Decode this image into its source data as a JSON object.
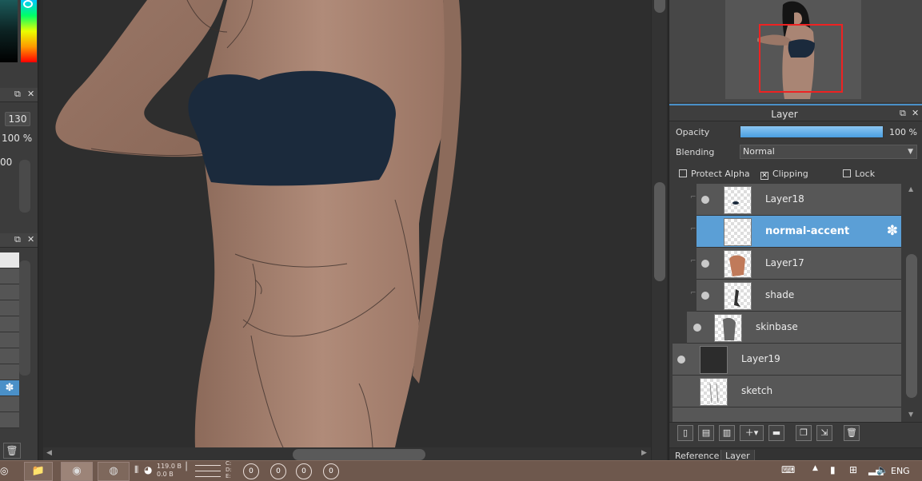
{
  "left_panel": {
    "brush_size": "130",
    "opacity_text": "100 %",
    "partial_value": "00"
  },
  "layer_panel": {
    "title": "Layer",
    "opacity_label": "Opacity",
    "opacity_value": "100 %",
    "opacity_fraction": 1.0,
    "blending_label": "Blending",
    "blending_value": "Normal",
    "protect_alpha": {
      "label": "Protect Alpha",
      "checked": false
    },
    "clipping": {
      "label": "Clipping",
      "checked": true
    },
    "lock": {
      "label": "Lock",
      "checked": false
    },
    "layers": [
      {
        "name": "Layer18",
        "visible": true,
        "clipped": true,
        "selected": false
      },
      {
        "name": "normal-accent",
        "visible": false,
        "clipped": true,
        "selected": true
      },
      {
        "name": "Layer17",
        "visible": true,
        "clipped": true,
        "selected": false
      },
      {
        "name": "shade",
        "visible": true,
        "clipped": true,
        "selected": false
      },
      {
        "name": "skinbase",
        "visible": true,
        "clipped": false,
        "selected": false
      },
      {
        "name": "Layer19",
        "visible": true,
        "clipped": false,
        "selected": false
      },
      {
        "name": "sketch",
        "visible": false,
        "clipped": false,
        "selected": false
      }
    ],
    "bottom_tabs": [
      "Reference",
      "Layer"
    ],
    "active_tab": "Layer"
  },
  "toolbar_icons": [
    "new-layer-icon",
    "new-8bit-layer-icon",
    "new-1bit-layer-icon",
    "add-layer-menu-icon",
    "new-folder-icon",
    "duplicate-layer-icon",
    "merge-layer-icon",
    "delete-layer-icon"
  ],
  "taskbar": {
    "disk_info": "119.0 B\n0.0 B",
    "drive_labels": "C:\nD:\nE:",
    "counters": [
      "0",
      "0",
      "0",
      "0"
    ],
    "language": "ENG"
  },
  "colors": {
    "accent": "#5b9fd6",
    "selection_frame": "#ee2222",
    "skin": "#a98574",
    "top_fabric": "#1b2a3c"
  }
}
